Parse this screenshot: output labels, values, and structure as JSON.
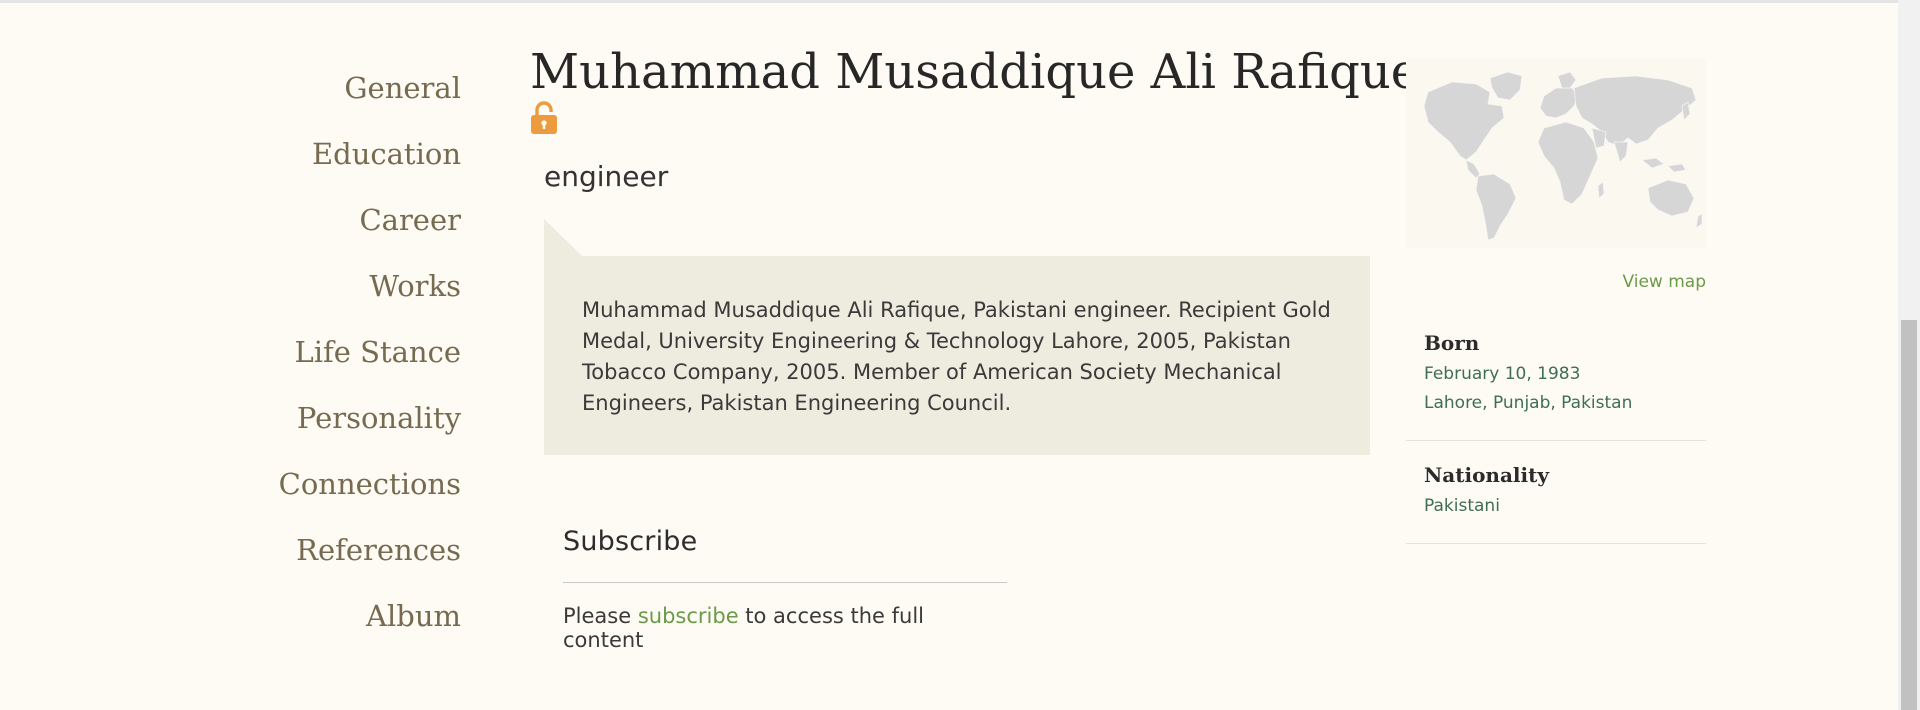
{
  "nav": {
    "items": [
      {
        "label": "General"
      },
      {
        "label": "Education"
      },
      {
        "label": "Career"
      },
      {
        "label": "Works"
      },
      {
        "label": "Life Stance"
      },
      {
        "label": "Personality"
      },
      {
        "label": "Connections"
      },
      {
        "label": "References"
      },
      {
        "label": "Album"
      }
    ]
  },
  "profile": {
    "name": "Muhammad Musaddique Ali Rafique",
    "lock_icon": "lock-open-icon",
    "occupation": "engineer",
    "bio": "Muhammad Musaddique Ali Rafique, Pakistani engineer. Recipient Gold Medal, University Engineering & Technology Lahore, 2005, Pakistan Tobacco Company, 2005. Member of American Society Mechanical Engineers, Pakistan Engineering Council."
  },
  "subscribe": {
    "heading": "Subscribe",
    "text_before": "Please ",
    "link": "subscribe",
    "text_after": " to access the full content"
  },
  "sidebar": {
    "view_map": "View map",
    "born": {
      "label": "Born",
      "date": "February 10, 1983",
      "place": "Lahore, Punjab, Pakistan"
    },
    "nationality": {
      "label": "Nationality",
      "value": "Pakistani"
    }
  },
  "colors": {
    "background": "#fdfbf3",
    "nav_text": "#766a50",
    "link_green": "#6b9a4a",
    "fact_green": "#3e6e56",
    "bio_box": "#eeebdf",
    "lock_orange": "#ed9b3f",
    "map_land": "#d6d6d6"
  }
}
